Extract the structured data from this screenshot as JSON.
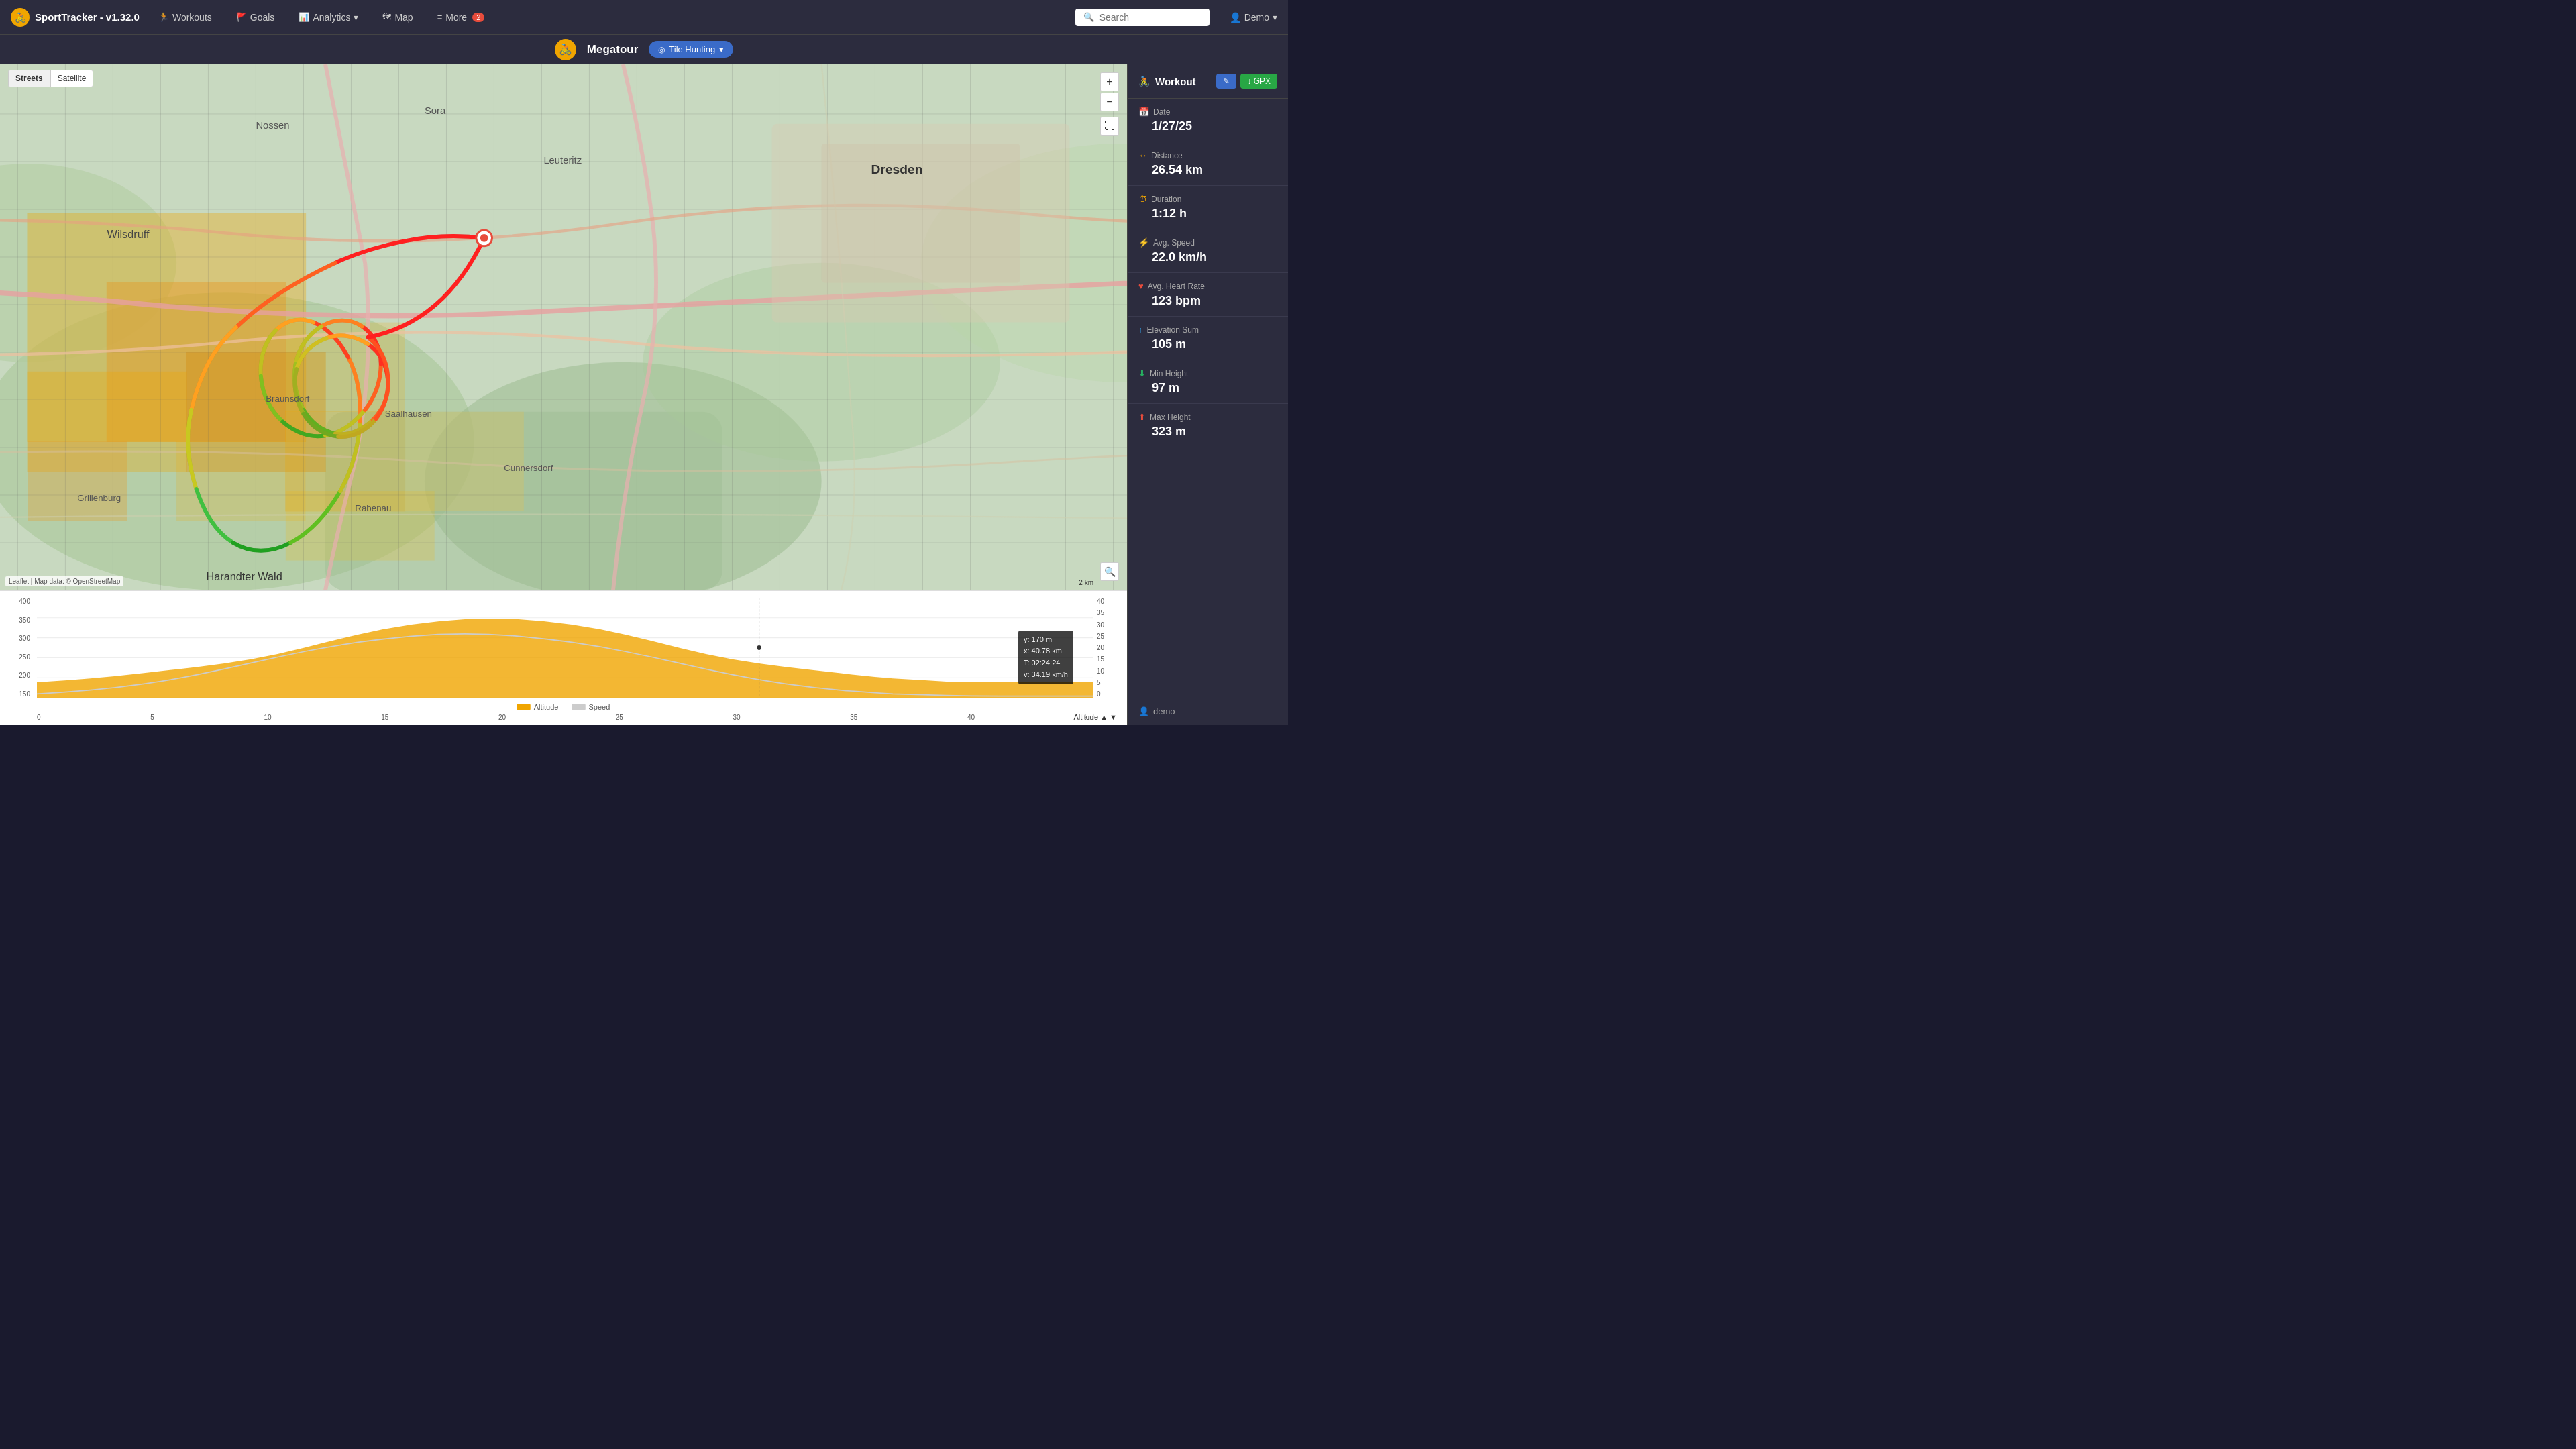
{
  "app": {
    "title": "SportTracker - v1.32.0",
    "brand_icon": "🚴"
  },
  "navbar": {
    "brand": "SportTracker - v1.32.0",
    "workouts_label": "Workouts",
    "goals_label": "Goals",
    "analytics_label": "Analytics",
    "map_label": "Map",
    "more_label": "More",
    "more_badge": "2",
    "search_placeholder": "Search",
    "user_label": "Demo"
  },
  "center_header": {
    "tour_name": "Megatour",
    "tile_hunting_label": "Tile Hunting"
  },
  "map": {
    "type_streets": "Streets",
    "type_satellite": "Satellite",
    "attribution": "Leaflet",
    "attribution_data": "Map data: © OpenStreetMap",
    "scale": "2 km"
  },
  "sidebar": {
    "workout_title": "Workout",
    "edit_label": "✎",
    "gpx_label": "↓ GPX",
    "date_label": "Date",
    "date_value": "1/27/25",
    "distance_label": "Distance",
    "distance_value": "26.54 km",
    "duration_label": "Duration",
    "duration_value": "1:12 h",
    "avg_speed_label": "Avg. Speed",
    "avg_speed_value": "22.0 km/h",
    "avg_heart_label": "Avg. Heart Rate",
    "avg_heart_value": "123 bpm",
    "elevation_label": "Elevation Sum",
    "elevation_value": "105 m",
    "min_height_label": "Min Height",
    "min_height_value": "97 m",
    "max_height_label": "Max Height",
    "max_height_value": "323 m",
    "user_label": "demo"
  },
  "chart": {
    "y_labels": [
      "400",
      "350",
      "300",
      "250",
      "200",
      "150"
    ],
    "x_labels": [
      "0",
      "5",
      "10",
      "15",
      "20",
      "25",
      "30",
      "35",
      "40"
    ],
    "y_right_labels": [
      "40",
      "35",
      "30",
      "25",
      "20",
      "15",
      "10",
      "5",
      "0"
    ],
    "altitude_label": "Altitude",
    "speed_label": "Speed",
    "units_left": "m",
    "units_right": "km/h",
    "tooltip": {
      "y": "y: 170 m",
      "x": "x: 40.78 km",
      "t": "T: 02:24:24",
      "v": "v: 34.19 km/h"
    }
  }
}
